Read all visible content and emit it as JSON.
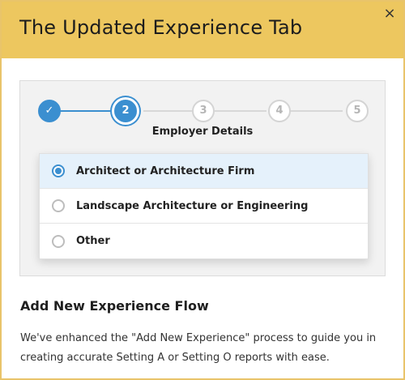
{
  "modal": {
    "title": "The Updated Experience Tab",
    "close_icon": "×"
  },
  "stepper": {
    "steps": [
      {
        "label": "✓",
        "state": "done"
      },
      {
        "label": "2",
        "state": "current"
      },
      {
        "label": "3",
        "state": "upcoming"
      },
      {
        "label": "4",
        "state": "upcoming"
      },
      {
        "label": "5",
        "state": "upcoming"
      }
    ],
    "current_title": "Employer Details"
  },
  "options": [
    {
      "label": "Architect or Architecture Firm",
      "selected": true
    },
    {
      "label": "Landscape Architecture or Engineering",
      "selected": false
    },
    {
      "label": "Other",
      "selected": false
    }
  ],
  "section": {
    "title": "Add New Experience Flow",
    "body": "We've enhanced the \"Add New Experience\" process to guide you in creating accurate Setting A or Setting O reports with ease."
  },
  "colors": {
    "header_bg": "#edc75f",
    "accent": "#3b8fd0",
    "selected_row": "#e5f1fb"
  }
}
